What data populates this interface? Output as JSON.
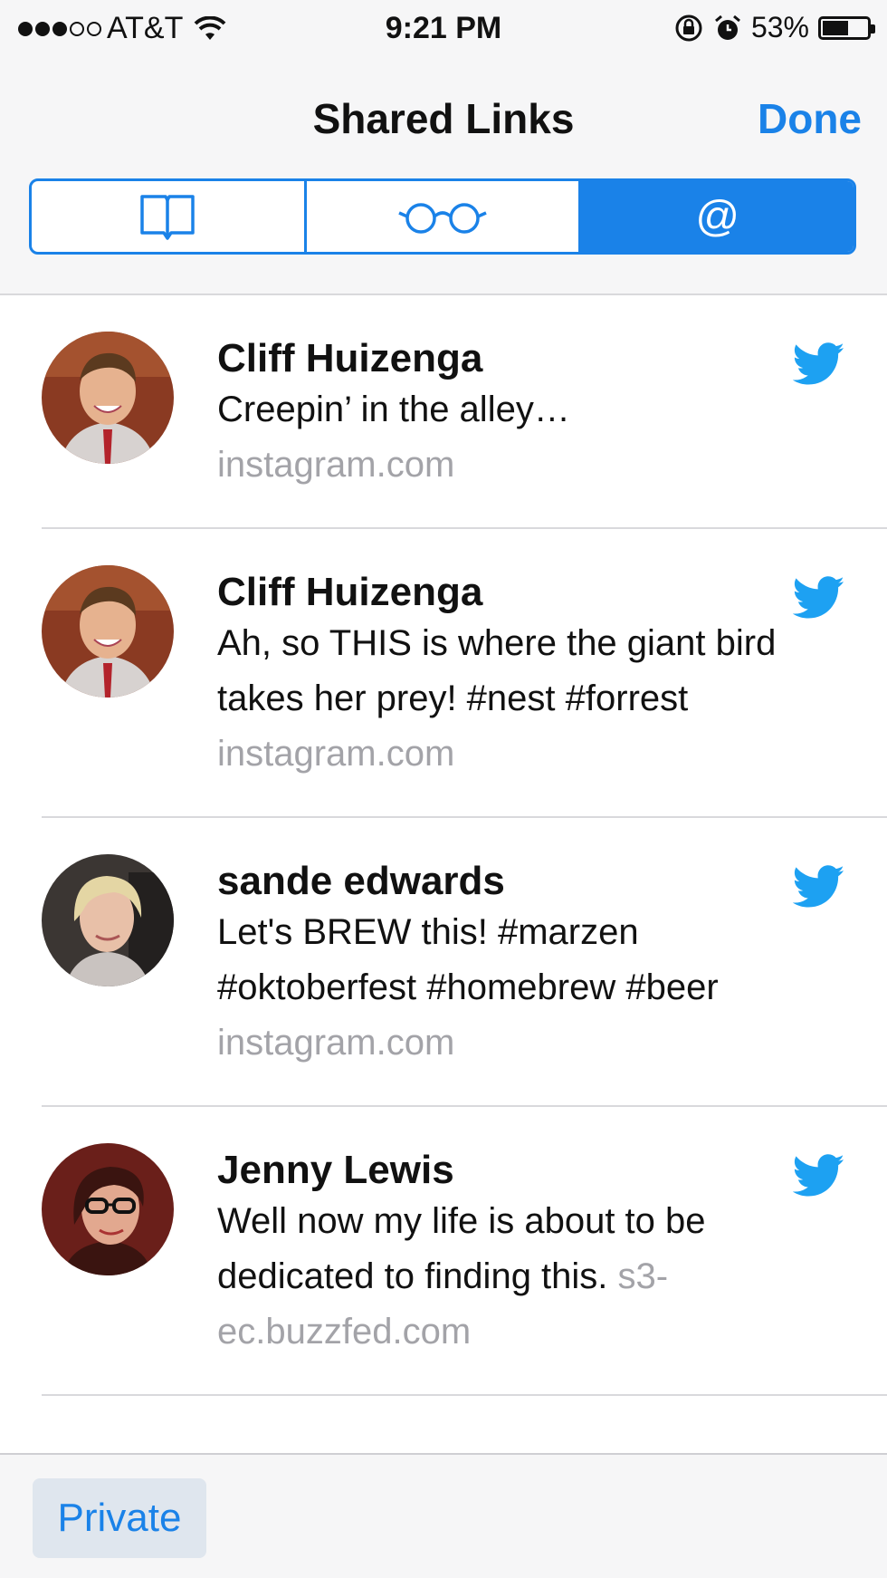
{
  "status_bar": {
    "signal": "●●●○○",
    "carrier": "AT&T",
    "time": "9:21 PM",
    "battery": "53%"
  },
  "nav": {
    "title": "Shared Links",
    "done_label": "Done"
  },
  "segments": [
    {
      "icon": "book-icon",
      "active": false
    },
    {
      "icon": "glasses-icon",
      "active": false
    },
    {
      "icon": "at-icon",
      "label": "@",
      "active": true
    }
  ],
  "links": [
    {
      "author": "Cliff Huizenga",
      "text": "Creepin’ in the alley…",
      "domain": "instagram.com",
      "source_icon": "twitter-bird-icon"
    },
    {
      "author": "Cliff Huizenga",
      "text": "Ah, so THIS is where the giant bird takes her prey! #nest #forrest",
      "domain": "instagram.com",
      "source_icon": "twitter-bird-icon"
    },
    {
      "author": "sande edwards",
      "text": "Let's BREW this! #marzen #oktoberfest #homebrew #beer",
      "domain": "instagram.com",
      "source_icon": "twitter-bird-icon"
    },
    {
      "author": "Jenny Lewis",
      "text": "Well now my life is about to be dedicated to finding this.",
      "domain": "s3-ec.buzzfed.com",
      "source_icon": "twitter-bird-icon"
    }
  ],
  "toolbar": {
    "private_label": "Private"
  },
  "colors": {
    "accent": "#1a82e8",
    "twitter": "#1da1f2",
    "secondary_text": "#a3a3a8"
  }
}
